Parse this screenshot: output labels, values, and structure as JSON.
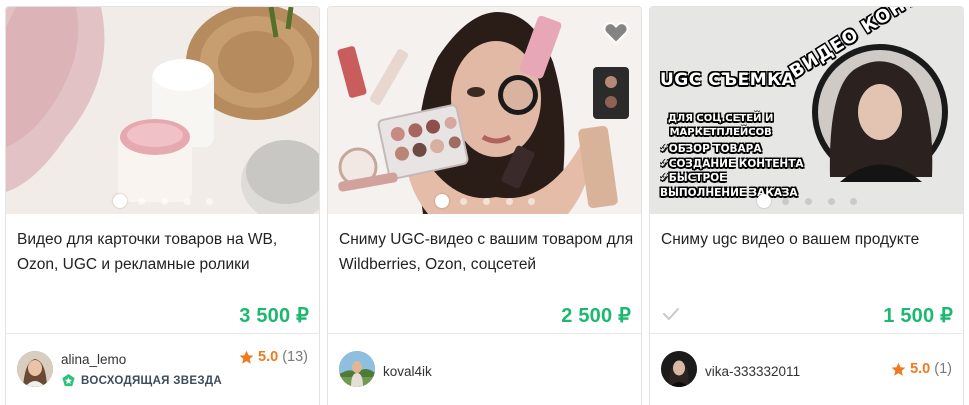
{
  "listings": [
    {
      "title": "Видео для карточки товаров на WB, Ozon, UGC и рекламные ролики",
      "price": "3 500 ₽",
      "seller": {
        "username": "alina_lemo",
        "badge": "ВОСХОДЯЩАЯ ЗВЕЗДА"
      },
      "rating": {
        "value": "5.0",
        "count": "(13)"
      },
      "image_icon": "cosmetics-photo",
      "slides": 5,
      "active_slide": 1
    },
    {
      "title": "Сниму UGC-видео с вашим товаром для Wildberries, Ozon, соцсетей",
      "price": "2 500 ₽",
      "seller": {
        "username": "koval4ik"
      },
      "image_icon": "makeup-photo",
      "favorite_icon": "heart-icon",
      "slides": 5,
      "active_slide": 1
    },
    {
      "title": "Сниму ugc видео о вашем продукте",
      "price": "1 500 ₽",
      "seller": {
        "username": "vika-333332011"
      },
      "rating": {
        "value": "5.0",
        "count": "(1)"
      },
      "image_icon": "promo-banner",
      "promo": {
        "heading": "UGC СЪЕМКА",
        "circle_text": "ВИДЕО КОНТЕНТ",
        "sub_lines": [
          "ДЛЯ СОЦ.СЕТЕЙ И",
          "МАРКЕТПЛЕЙСОВ"
        ],
        "list": [
          "✓ОБЗОР ТОВАРА",
          "✓СОЗДАНИЕ КОНТЕНТА",
          "✓БЫСТРОЕ",
          "ВЫПОЛНЕНИЕ ЗАКАЗА"
        ]
      },
      "slides": 5,
      "active_slide": 1
    }
  ],
  "colors": {
    "price": "#1cb870",
    "rating_value": "#f07a1e",
    "badge_icon": "#2ec07a",
    "border": "#e3e3e3"
  }
}
